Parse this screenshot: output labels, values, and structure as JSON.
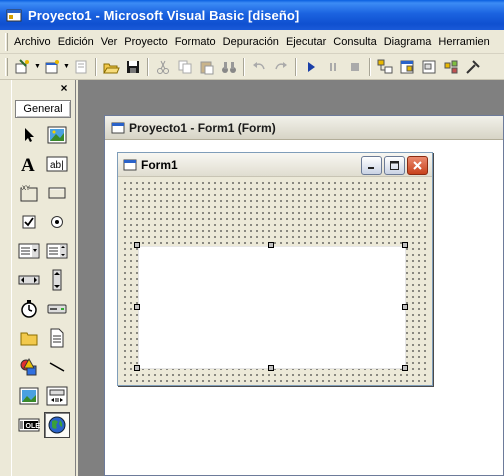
{
  "app": {
    "title": "Proyecto1 - Microsoft Visual Basic [diseño]"
  },
  "menu": {
    "items": [
      "Archivo",
      "Edición",
      "Ver",
      "Proyecto",
      "Formato",
      "Depuración",
      "Ejecutar",
      "Consulta",
      "Diagrama",
      "Herramien"
    ]
  },
  "toolbox": {
    "tab_label": "General",
    "close_label": "×",
    "tools": [
      "pointer-icon",
      "picturebox-icon",
      "label-icon",
      "textbox-icon",
      "frame-icon",
      "commandbutton-icon",
      "checkbox-icon",
      "optionbutton-icon",
      "combobox-icon",
      "listbox-icon",
      "hscrollbar-icon",
      "vscrollbar-icon",
      "timer-icon",
      "drivelistbox-icon",
      "dirlistbox-icon",
      "filelistbox-icon",
      "shape-icon",
      "line-icon",
      "image-icon",
      "data-icon",
      "ole-icon",
      "webbrowser-icon"
    ]
  },
  "project_window": {
    "title": "Proyecto1 - Form1 (Form)"
  },
  "form": {
    "title": "Form1"
  },
  "colors": {
    "titlebar": "#0f50d0",
    "workspace": "#808080",
    "close_button": "#c8421c"
  }
}
